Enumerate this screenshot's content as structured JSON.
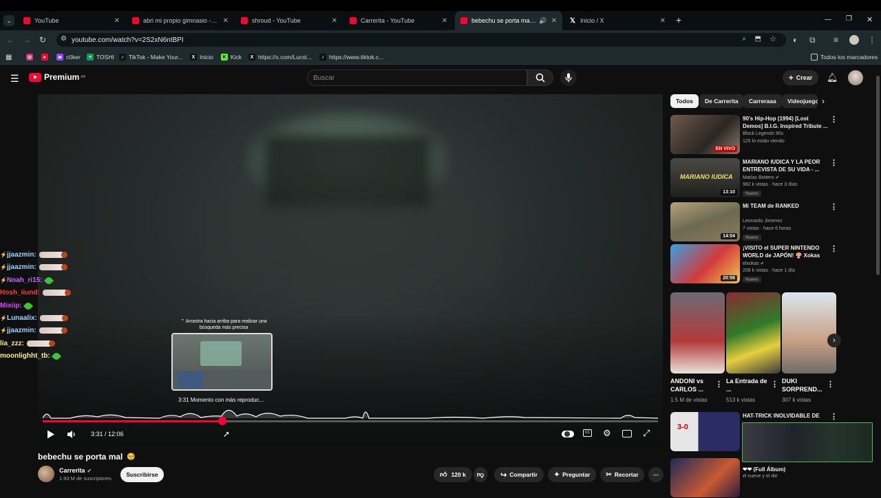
{
  "browser": {
    "tabs": [
      {
        "label": "YouTube",
        "favicon": "youtube-icon",
        "active": false
      },
      {
        "label": "abri mi propio gimnasio - YouT",
        "favicon": "youtube-icon",
        "active": false
      },
      {
        "label": "shroud - YouTube",
        "favicon": "youtube-icon",
        "active": false
      },
      {
        "label": "Carrerita - YouTube",
        "favicon": "youtube-icon",
        "active": false
      },
      {
        "label": "bebechu se porta mal 🥺 -",
        "favicon": "youtube-icon",
        "active": true
      },
      {
        "label": "Inicio / X",
        "favicon": "x-icon",
        "active": false
      }
    ],
    "new_tab": "+",
    "url": "youtube.com/watch?v=2S2xN6ntBPI",
    "bookmarks": [
      {
        "label": "",
        "icon": "instagram-icon"
      },
      {
        "label": "",
        "icon": "youtube-icon"
      },
      {
        "label": "c0ker",
        "icon": "twitch-icon"
      },
      {
        "label": "TOSHI",
        "icon": "sheets-icon"
      },
      {
        "label": "TikTok - Make Your...",
        "icon": "tiktok-icon"
      },
      {
        "label": "Inicio",
        "icon": "x-icon"
      },
      {
        "label": "Kick",
        "icon": "kick-icon"
      },
      {
        "label": "https://x.com/Lucst...",
        "icon": "x-icon"
      },
      {
        "label": "https://www.tiktok.c...",
        "icon": "tiktok-icon"
      }
    ],
    "all_bookmarks": "Todos los marcadores"
  },
  "header": {
    "logo": "Premium",
    "region": "AR",
    "search_placeholder": "Buscar",
    "create_label": "Crear"
  },
  "player": {
    "chat": [
      {
        "user": "jjaazmin:",
        "color": "#9ad6ff",
        "emote": "cigarette"
      },
      {
        "user": "jjaazmin:",
        "color": "#9ad6ff",
        "emote": "cigarette"
      },
      {
        "user": "Noah_ri15:",
        "color": "#c266ff",
        "emote": "leaf"
      },
      {
        "user": "Hosh_iiund:",
        "color": "#ff3b3b",
        "emote": "cigarette"
      },
      {
        "user": "Mixiip:",
        "color": "#d54bff",
        "emote": "leaf"
      },
      {
        "user": "Lunaalix:",
        "color": "#9ad6ff",
        "emote": "cigarette"
      },
      {
        "user": "jjaazmin:",
        "color": "#9ad6ff",
        "emote": "cigarette"
      },
      {
        "user": "lia_zzz:",
        "color": "#f7f08a",
        "emote": "cigarette"
      },
      {
        "user": "moonlighht_tb:",
        "color": "#f7f08a",
        "emote": "leaf"
      }
    ],
    "seek_hint": "Arrastra hacia arriba para realizar una búsqueda más precisa",
    "preview_label": "3:31  Momento con más reproduc...",
    "time": "3:31 / 12:06",
    "progress": 0.292
  },
  "video": {
    "title": "bebechu se porta mal",
    "title_emoji": "🥺",
    "channel": "Carrerita",
    "subscribers": "1.93 M de suscriptores",
    "subscribe_label": "Suscribirse",
    "likes": "120 k",
    "share_label": "Compartir",
    "ask_label": "Preguntar",
    "clip_label": "Recortar"
  },
  "sidebar": {
    "chips": [
      {
        "label": "Todos",
        "active": true
      },
      {
        "label": "De Carrerita",
        "active": false
      },
      {
        "label": "Carreraaa",
        "active": false
      },
      {
        "label": "Videojuegos",
        "active": false
      }
    ],
    "recommendations": [
      {
        "title": "90's Hip-Hop (1994) [Lost Demos] B.I.G. Inspired Tribute ...",
        "channel": "Block Legends 90s",
        "meta": "125 lo están viendo",
        "badge": "EN VIVO",
        "duration": "",
        "new": false
      },
      {
        "title": "MARIANO IUDICA Y LA PEOR ENTREVISTA DE SU VIDA - ...",
        "channel": "Matías Bottero",
        "meta": "982 k vistas · hace 3 días",
        "badge": "",
        "duration": "13:10",
        "new": true
      },
      {
        "title": "Mi TEAM de RANKED",
        "channel": "Leonardo Jimenez",
        "meta": "7 vistas · hace 6 horas",
        "badge": "",
        "duration": "14:04",
        "new": true
      },
      {
        "title": "¡VISITO el SUPER NINTENDO WORLD de JAPÓN! 🍄 Xokas",
        "channel": "elxokas",
        "meta": "208 k vistas · hace 1 día",
        "badge": "",
        "duration": "20:56",
        "new": true
      }
    ],
    "new_label": "Nuevo",
    "shorts": [
      {
        "title": "ANDONI vs CARLOS ...",
        "views": "1.5 M de vistas"
      },
      {
        "title": "La Entrada de ...",
        "views": "513 k vistas"
      },
      {
        "title": "DUKI SORPREND...",
        "views": "307 k vistas"
      }
    ],
    "bottom": [
      {
        "title": "HAT-TRICK INOLVIDABLE DE",
        "thumb_text": "3-0"
      },
      {
        "title": "❤❤ (Full Álbum)",
        "channel": "el nueve y el die"
      }
    ]
  }
}
